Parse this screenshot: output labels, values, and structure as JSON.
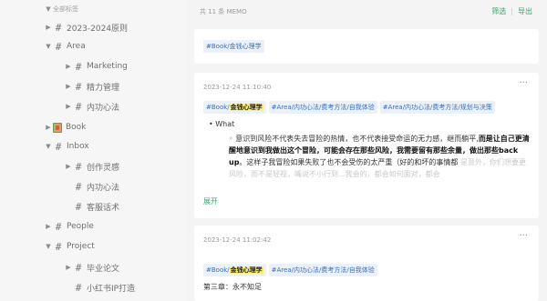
{
  "sidebar": {
    "top_label": "全部标签",
    "items": [
      {
        "label": "2023-2024原则",
        "icon": "hash-icon",
        "expanded": false
      },
      {
        "label": "Area",
        "icon": "hash-icon",
        "expanded": true
      },
      {
        "label": "Marketing",
        "icon": "hash-icon",
        "expanded": false
      },
      {
        "label": "精力管理",
        "icon": "hash-icon",
        "expanded": false
      },
      {
        "label": "内功心法",
        "icon": "hash-icon",
        "expanded": false
      },
      {
        "label": "Book",
        "icon": "book-emoji-icon",
        "expanded": false
      },
      {
        "label": "Inbox",
        "icon": "hash-icon",
        "expanded": true
      },
      {
        "label": "创作灵感",
        "icon": "hash-icon",
        "expanded": false
      },
      {
        "label": "内功心法",
        "icon": "hash-icon",
        "expanded": false
      },
      {
        "label": "客服话术",
        "icon": "hash-icon",
        "expanded": false
      },
      {
        "label": "People",
        "icon": "hash-icon",
        "expanded": false
      },
      {
        "label": "Project",
        "icon": "hash-icon",
        "expanded": true
      },
      {
        "label": "毕业论文",
        "icon": "hash-icon",
        "expanded": false
      },
      {
        "label": "小红书IP打造",
        "icon": "hash-icon",
        "expanded": false
      }
    ]
  },
  "header": {
    "count": "共 11 条 MEMO",
    "filter_label": "筛选",
    "separator": "|",
    "export_label": "导出"
  },
  "filter_tag": "#Book/金钱心理学",
  "memos": [
    {
      "timestamp": "2023-12-24 11:10:40",
      "more": "···",
      "tags": [
        {
          "prefix": "#Book/",
          "highlight": "金钱心理学",
          "suffix": ""
        },
        {
          "prefix": "#Area/内功心法/费考方法/自我体验",
          "highlight": "",
          "suffix": ""
        },
        {
          "prefix": "#Area/内功心法/费考方法/规划与决策",
          "highlight": "",
          "suffix": ""
        }
      ],
      "bullet": "What",
      "text_normal_1": "意识到风险不代表失去冒险的热情，也不代表接受命运的无力感，继而躺平,",
      "text_bold_1": "而是让自己更清醒地意识到我做出这个冒险，可能会存在那些风险，我需要留有那些余量，做出那些back up",
      "text_normal_2": "。这样子我冒险如果失败了也不会受伤的太严重（好的和坏的事情都",
      "text_faded": "是意外，你们想要更风险，而不是轻视，嘴说不小行到...我会的，都会如何面对，都会",
      "expand": "展开"
    },
    {
      "timestamp": "2023-12-24 11:02:42",
      "more": "···",
      "tags": [
        {
          "prefix": "#Book/",
          "highlight": "金钱心理学",
          "suffix": ""
        },
        {
          "prefix": "#Area/内功心法/费考方法/自我体验",
          "highlight": "",
          "suffix": ""
        }
      ],
      "chapter": "第三章：永不知足"
    }
  ],
  "colors": {
    "accent": "#3aa76d",
    "tag_bg": "#eaf1fb",
    "tag_text": "#3b6eb4",
    "highlight": "#ffef7a"
  }
}
